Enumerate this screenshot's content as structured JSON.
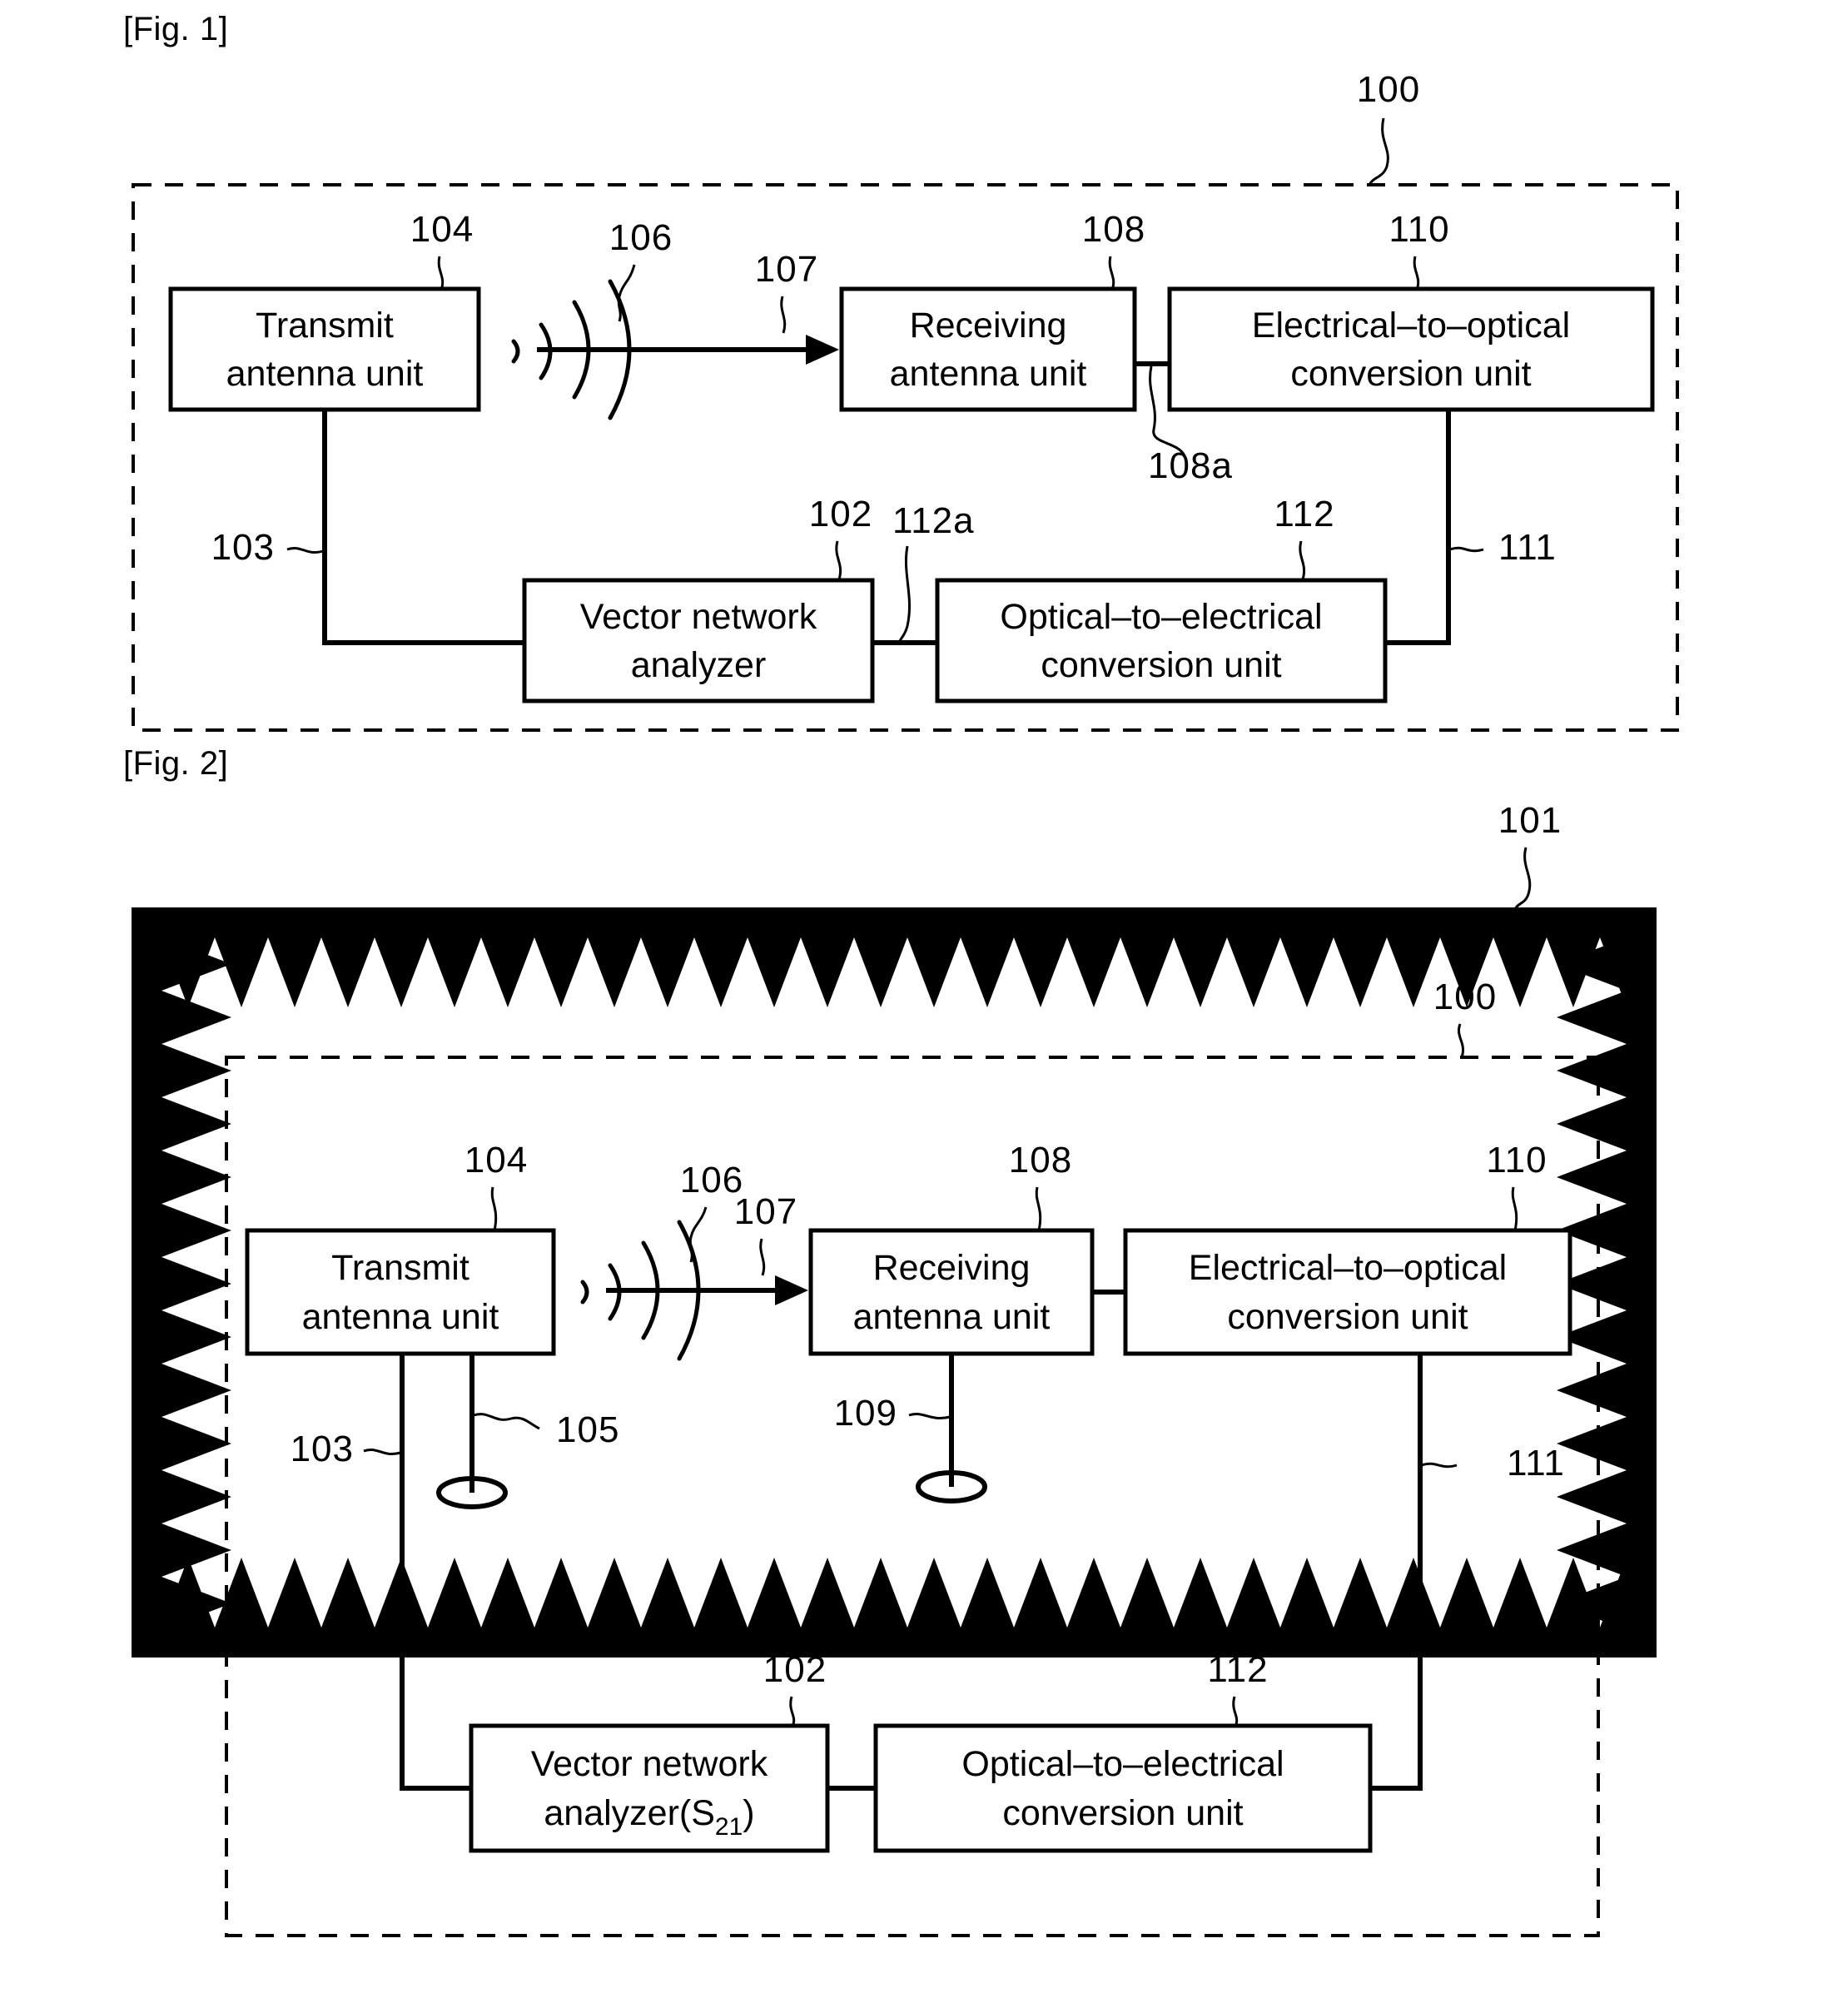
{
  "document": {
    "type": "patent-figure-sheet",
    "figures": [
      {
        "caption": "[Fig. 1]",
        "enclosure_ref": "100",
        "blocks": [
          {
            "ref": "104",
            "line1": "Transmit",
            "line2": "antenna unit"
          },
          {
            "ref": "108",
            "line1": "Receiving",
            "line2": "antenna unit"
          },
          {
            "ref": "110",
            "line1": "Electrical–to–optical",
            "line2": "conversion unit"
          },
          {
            "ref": "102",
            "line1": "Vector network",
            "line2": "analyzer"
          },
          {
            "ref": "112",
            "line1": "Optical–to–electrical",
            "line2": "conversion unit"
          }
        ],
        "connector_refs": [
          "103",
          "106",
          "107",
          "108a",
          "111",
          "112a"
        ]
      },
      {
        "caption": "[Fig. 2]",
        "chamber_ref": "101",
        "enclosure_ref": "100",
        "blocks": [
          {
            "ref": "104",
            "line1": "Transmit",
            "line2": "antenna unit"
          },
          {
            "ref": "108",
            "line1": "Receiving",
            "line2": "antenna unit"
          },
          {
            "ref": "110",
            "line1": "Electrical–to–optical",
            "line2": "conversion unit"
          },
          {
            "ref": "102",
            "line1": "Vector network",
            "line2_prefix": "analyzer(S",
            "line2_sub": "21",
            "line2_suffix": ")"
          },
          {
            "ref": "112",
            "line1": "Optical–to–electrical",
            "line2": "conversion unit"
          }
        ],
        "connector_refs": [
          "103",
          "105",
          "106",
          "107",
          "109",
          "111"
        ]
      }
    ]
  },
  "fig1": {
    "caption": "[Fig. 1]",
    "ref_100": "100",
    "ref_104": "104",
    "ref_106": "106",
    "ref_107": "107",
    "ref_108": "108",
    "ref_108a": "108a",
    "ref_110": "110",
    "ref_111": "111",
    "ref_103": "103",
    "ref_102": "102",
    "ref_112": "112",
    "ref_112a": "112a",
    "transmit_l1": "Transmit",
    "transmit_l2": "antenna unit",
    "receiving_l1": "Receiving",
    "receiving_l2": "antenna unit",
    "eo_l1": "Electrical–to–optical",
    "eo_l2": "conversion unit",
    "vna_l1": "Vector network",
    "vna_l2": "analyzer",
    "oe_l1": "Optical–to–electrical",
    "oe_l2": "conversion unit"
  },
  "fig2": {
    "caption": "[Fig. 2]",
    "ref_101": "101",
    "ref_100": "100",
    "ref_104": "104",
    "ref_106": "106",
    "ref_107": "107",
    "ref_108": "108",
    "ref_110": "110",
    "ref_111": "111",
    "ref_103": "103",
    "ref_105": "105",
    "ref_109": "109",
    "ref_102": "102",
    "ref_112": "112",
    "transmit_l1": "Transmit",
    "transmit_l2": "antenna unit",
    "receiving_l1": "Receiving",
    "receiving_l2": "antenna unit",
    "eo_l1": "Electrical–to–optical",
    "eo_l2": "conversion unit",
    "vna_l1": "Vector network",
    "vna_l2_prefix": "analyzer(S",
    "vna_l2_sub": "21",
    "vna_l2_suffix": ")",
    "oe_l1": "Optical–to–electrical",
    "oe_l2": "conversion unit"
  },
  "colors": {
    "ink": "#000000",
    "paper": "#ffffff"
  }
}
